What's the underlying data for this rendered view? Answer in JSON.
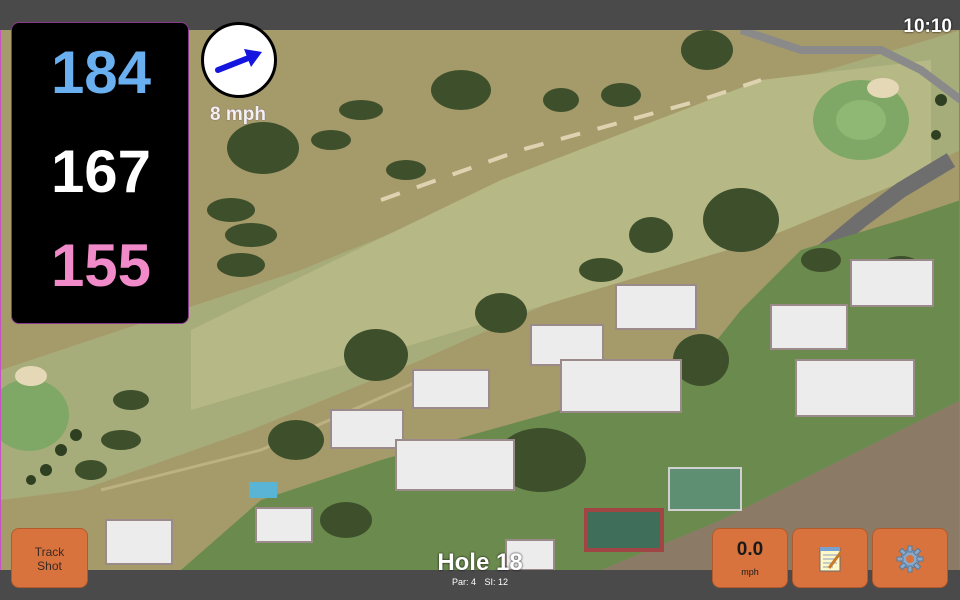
{
  "clock": "10:10",
  "distances": {
    "back": "184",
    "middle": "167",
    "front": "155",
    "back_color": "#6ab0f0",
    "middle_color": "#ffffff",
    "front_color": "#f08ac8"
  },
  "wind": {
    "icon": "wind-arrow-icon",
    "speed": "8 mph"
  },
  "buttons": {
    "track_line1": "Track",
    "track_line2": "Shot",
    "speed_value": "0.0",
    "speed_unit": "mph",
    "notes_icon": "notepad-icon",
    "settings_icon": "gear-icon"
  },
  "hole": {
    "title": "Hole 18",
    "par": "Par: 4",
    "si": "SI: 12"
  },
  "colors": {
    "button_orange": "#d9733e",
    "frame_accent": "#c653c6",
    "bar": "#4a4a4a"
  }
}
